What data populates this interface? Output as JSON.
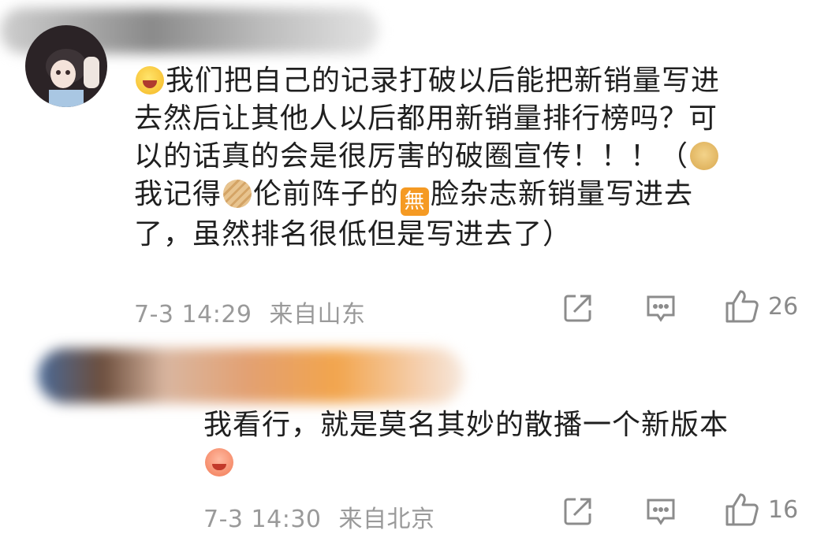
{
  "comments": [
    {
      "text_parts": [
        "我们把自己的记录打破以后能把新销量写进",
        "去然后让其他人以后都用新销量排行榜吗？可",
        "以的话真的会是很厉害的破圈宣传！！！（",
        "我记得",
        "伦前阵子的",
        "脸杂志新销量写进去",
        "了，虽然排名很低但是写进去了）"
      ],
      "emoji_1": "doge-emoji",
      "badge_char": "無",
      "date": "7-3 14:29",
      "location": "来自山东",
      "likes": "26"
    },
    {
      "text_parts": [
        "我看行，就是莫名其妙的散播一个新版本"
      ],
      "date": "7-3 14:30",
      "location": "来自北京",
      "likes": "16"
    }
  ],
  "colors": {
    "meta_gray": "#9a9a9a",
    "icon_gray": "#8c8c8c",
    "text": "#1f1f1f"
  }
}
